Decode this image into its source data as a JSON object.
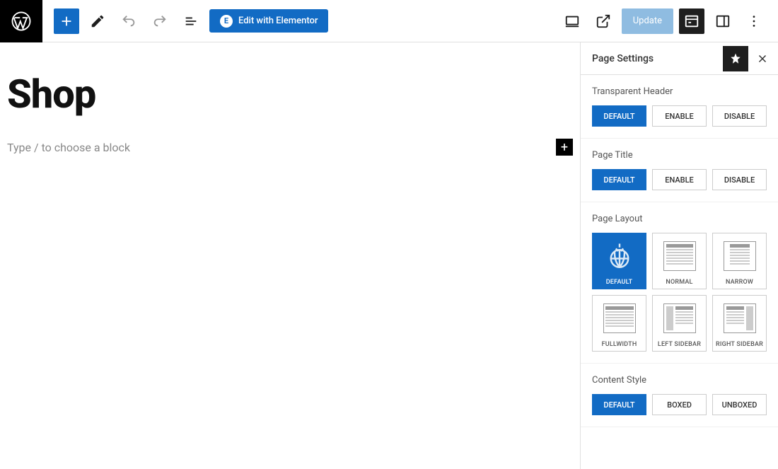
{
  "toolbar": {
    "elementor_label": "Edit with Elementor",
    "update_label": "Update"
  },
  "editor": {
    "title": "Shop",
    "placeholder": "Type / to choose a block"
  },
  "sidebar": {
    "title": "Page Settings",
    "sections": {
      "transparent_header": {
        "label": "Transparent Header",
        "options": [
          "DEFAULT",
          "ENABLE",
          "DISABLE"
        ],
        "selected": "DEFAULT"
      },
      "page_title": {
        "label": "Page Title",
        "options": [
          "DEFAULT",
          "ENABLE",
          "DISABLE"
        ],
        "selected": "DEFAULT"
      },
      "page_layout": {
        "label": "Page Layout",
        "options": [
          "DEFAULT",
          "NORMAL",
          "NARROW",
          "FULLWIDTH",
          "LEFT SIDEBAR",
          "RIGHT SIDEBAR"
        ],
        "selected": "DEFAULT"
      },
      "content_style": {
        "label": "Content Style",
        "options": [
          "DEFAULT",
          "BOXED",
          "UNBOXED"
        ],
        "selected": "DEFAULT"
      }
    }
  }
}
